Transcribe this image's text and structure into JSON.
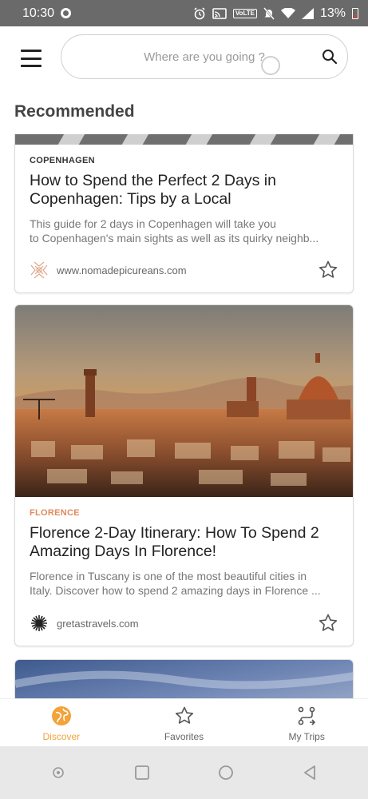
{
  "status_bar": {
    "time": "10:30",
    "volte": "VoLTE",
    "battery": "13%"
  },
  "search": {
    "placeholder": "Where are you going ?"
  },
  "section": {
    "title": "Recommended"
  },
  "cards": [
    {
      "category": "COPENHAGEN",
      "title": "How to Spend the Perfect 2 Days in Copenhagen: Tips by a Local",
      "desc_line1": "This guide for 2 days in Copenhagen will take you",
      "desc_line2": "to Copenhagen's main sights as well as its quirky neighb...",
      "source": "www.nomadepicureans.com"
    },
    {
      "category": "FLORENCE",
      "title": "Florence 2-Day Itinerary: How To Spend 2 Amazing Days In Florence!",
      "desc_line1": "Florence in Tuscany is one of the most beautiful cities in",
      "desc_line2": "Italy. Discover how to spend 2 amazing days in Florence ...",
      "source": "gretastravels.com"
    }
  ],
  "bottom_nav": {
    "items": [
      {
        "label": "Discover",
        "icon": "globe-icon",
        "active": true
      },
      {
        "label": "Favorites",
        "icon": "star-icon",
        "active": false
      },
      {
        "label": "My Trips",
        "icon": "route-icon",
        "active": false
      }
    ]
  },
  "colors": {
    "accent": "#f2a33a",
    "category_accent": "#e08a5c",
    "status_bar": "#6a6a6a"
  }
}
